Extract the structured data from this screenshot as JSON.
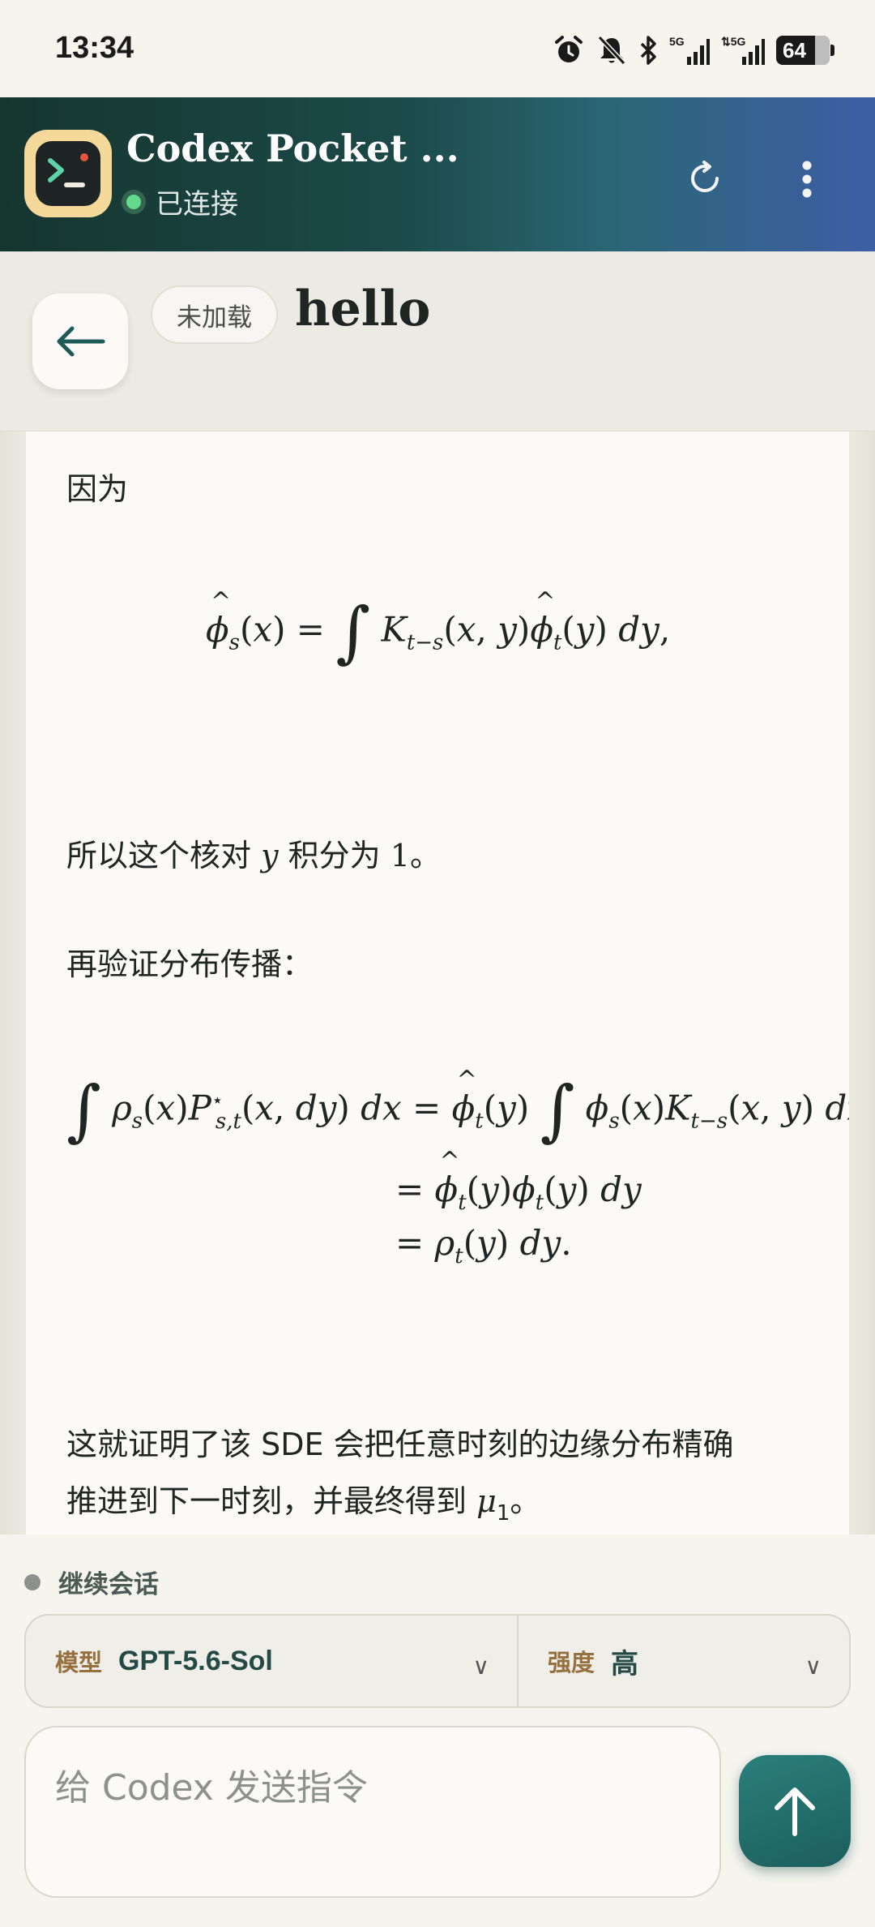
{
  "status_bar": {
    "time": "13:34",
    "battery": "64"
  },
  "app": {
    "title": "Codex Pocket ...",
    "connection_status": "已连接",
    "accent": "#1c5e5d",
    "icons": [
      "terminal-logo-icon",
      "refresh-icon",
      "more-vert-icon"
    ]
  },
  "thread": {
    "load_state": "未加载",
    "title": "hello"
  },
  "message": {
    "p1": "因为",
    "p2_before": "所以这个核对",
    "p2_var": "y",
    "p2_after": "积分为",
    "p2_num": "1",
    "p2_end": "。",
    "p3": "再验证分布传播：",
    "p4_line1": "这就证明了该 SDE 会把任意时刻的边缘分布精确",
    "p4_line2_before": "推进到下一时刻，并最终得到",
    "p4_var": "μ",
    "p4_sub": "1",
    "p4_end": "。"
  },
  "composer": {
    "continue_label": "继续会话",
    "model_label": "模型",
    "model_value": "GPT-5.6-Sol",
    "effort_label": "强度",
    "effort_value": "高",
    "placeholder": "给 Codex 发送指令"
  }
}
